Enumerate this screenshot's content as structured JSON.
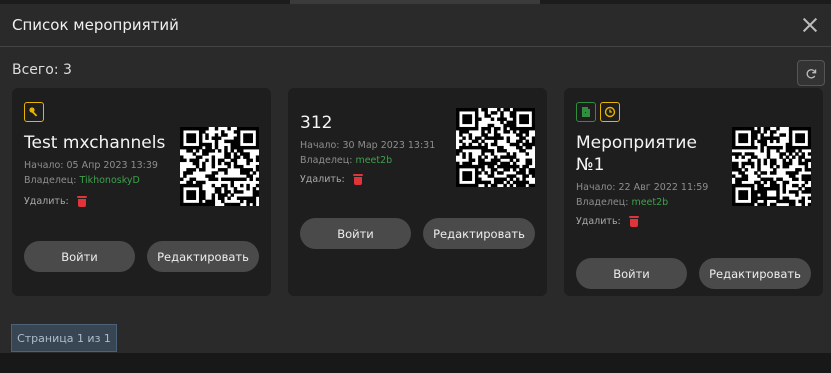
{
  "modal": {
    "title": "Список мероприятий"
  },
  "summary": {
    "total_label": "Всего: 3"
  },
  "labels": {
    "start_prefix": "Начало: ",
    "owner_prefix": "Владелец: ",
    "delete_label": "Удалить:"
  },
  "cards": [
    {
      "title": "Test mxchannels",
      "start": "05 Апр 2023 13:39",
      "owner": "TikhonoskyD",
      "badges": [
        "key-icon"
      ],
      "enter_label": "Войти",
      "edit_label": "Редактировать"
    },
    {
      "title": "312",
      "start": "30 Мар 2023 13:31",
      "owner": "meet2b",
      "badges": [],
      "enter_label": "Войти",
      "edit_label": "Редактировать"
    },
    {
      "title": "Мероприятие №1",
      "start": "22 Авг 2022 11:59",
      "owner": "meet2b",
      "badges": [
        "door-icon",
        "clock-icon"
      ],
      "enter_label": "Войти",
      "edit_label": "Редактировать"
    }
  ],
  "pagination": {
    "label": "Страница 1 из 1"
  },
  "colors": {
    "accent_yellow": "#e7b400",
    "accent_green": "#2f8f3e",
    "delete_red": "#e0333a",
    "owner_green": "#3ea04c"
  }
}
